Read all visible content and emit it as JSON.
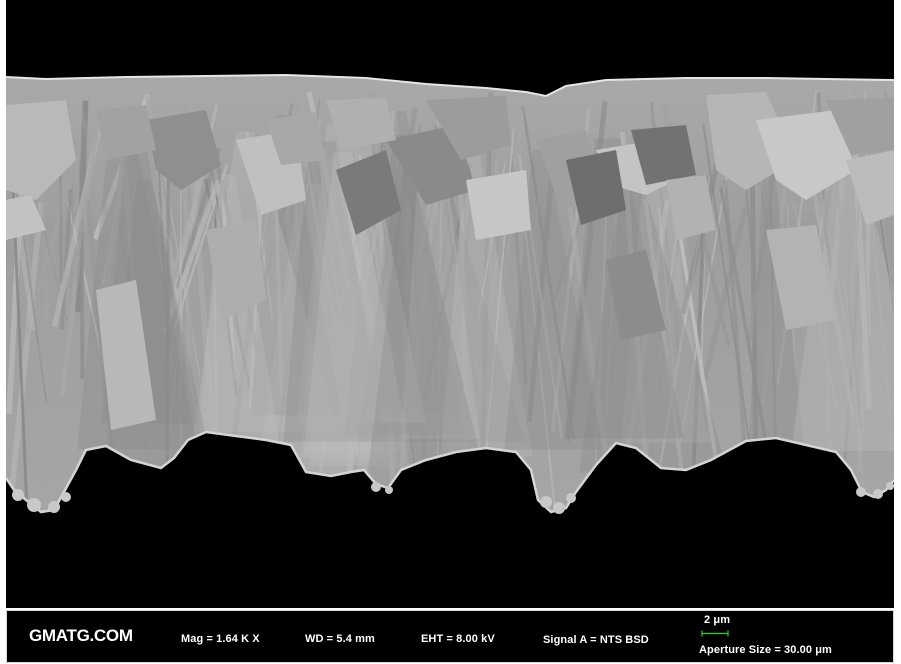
{
  "logo": "GMATG.COM",
  "info_bar": {
    "mag": "Mag =   1.64 K X",
    "wd": "WD =  5.4 mm",
    "eht": "EHT =  8.00 kV",
    "signal": "Signal A = NTS BSD",
    "scale_label": "2 μm",
    "aperture": "Aperture Size = 30.00 μm"
  },
  "colors": {
    "background": "#000000",
    "coating_light": "#b4b4b4",
    "coating_mid": "#9a9a9a",
    "coating_dark": "#6e6e6e",
    "scale_bar": "#2ecc40",
    "text": "#ffffff"
  }
}
